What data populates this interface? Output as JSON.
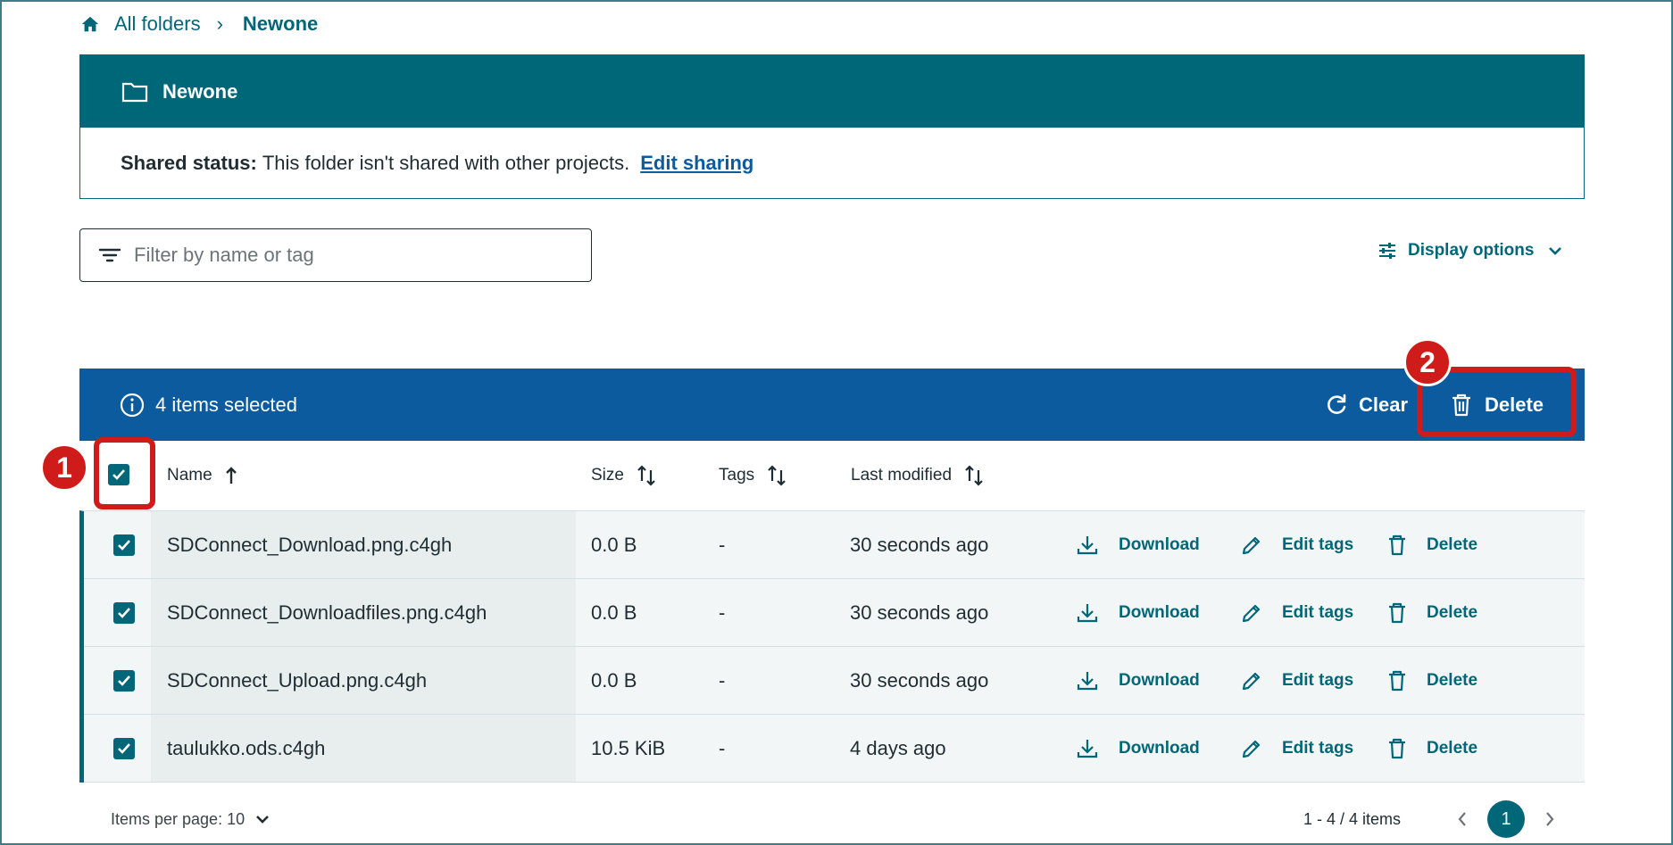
{
  "breadcrumb": {
    "home_icon": "home-icon",
    "root": "All folders",
    "separator": "›",
    "current": "Newone"
  },
  "folder": {
    "name": "Newone",
    "icon": "folder-icon",
    "shared_label": "Shared status:",
    "shared_text": "This folder isn't shared with other projects.",
    "edit_sharing": "Edit sharing"
  },
  "filter": {
    "placeholder": "Filter by name or tag",
    "value": ""
  },
  "display_options": {
    "label": "Display options"
  },
  "selection_bar": {
    "text": "4 items selected",
    "clear_label": "Clear",
    "delete_label": "Delete"
  },
  "annotations": {
    "badge1": "1",
    "badge2": "2",
    "color": "#d01b1b"
  },
  "table": {
    "headers": {
      "name": "Name",
      "size": "Size",
      "tags": "Tags",
      "modified": "Last modified"
    },
    "action_labels": {
      "download": "Download",
      "edit_tags": "Edit tags",
      "delete": "Delete"
    },
    "rows": [
      {
        "name": "SDConnect_Download.png.c4gh",
        "size": "0.0 B",
        "tags": "-",
        "modified": "30 seconds ago",
        "selected": true
      },
      {
        "name": "SDConnect_Downloadfiles.png.c4gh",
        "size": "0.0 B",
        "tags": "-",
        "modified": "30 seconds ago",
        "selected": true
      },
      {
        "name": "SDConnect_Upload.png.c4gh",
        "size": "0.0 B",
        "tags": "-",
        "modified": "30 seconds ago",
        "selected": true
      },
      {
        "name": "taulukko.ods.c4gh",
        "size": "10.5 KiB",
        "tags": "-",
        "modified": "4 days ago",
        "selected": true
      }
    ]
  },
  "pagination": {
    "items_per_page": "Items per page: 10",
    "range": "1 - 4 / 4 items",
    "current_page": "1"
  },
  "colors": {
    "teal": "#006778",
    "blue": "#0b5b9e"
  }
}
